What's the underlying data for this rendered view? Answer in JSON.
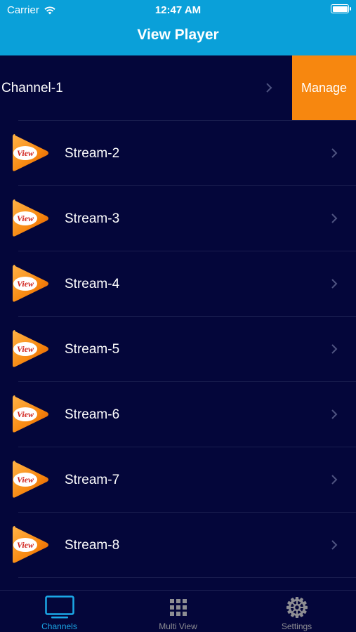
{
  "status_bar": {
    "carrier": "Carrier",
    "time": "12:47 AM"
  },
  "nav": {
    "title": "View Player"
  },
  "channel": {
    "label": "Channel-1",
    "action": "Manage"
  },
  "streams": [
    {
      "label": "Stream-2",
      "logo_text": "View"
    },
    {
      "label": "Stream-3",
      "logo_text": "View"
    },
    {
      "label": "Stream-4",
      "logo_text": "View"
    },
    {
      "label": "Stream-5",
      "logo_text": "View"
    },
    {
      "label": "Stream-6",
      "logo_text": "View"
    },
    {
      "label": "Stream-7",
      "logo_text": "View"
    },
    {
      "label": "Stream-8",
      "logo_text": "View"
    }
  ],
  "tabs": [
    {
      "label": "Channels",
      "icon": "tv-icon",
      "active": true
    },
    {
      "label": "Multi View",
      "icon": "grid-icon",
      "active": false
    },
    {
      "label": "Settings",
      "icon": "gear-icon",
      "active": false
    }
  ],
  "colors": {
    "header": "#0aa0d9",
    "background": "#04063a",
    "manage": "#f7870f",
    "tab_active": "#1ba8e8",
    "tab_inactive": "#8e8e93"
  }
}
